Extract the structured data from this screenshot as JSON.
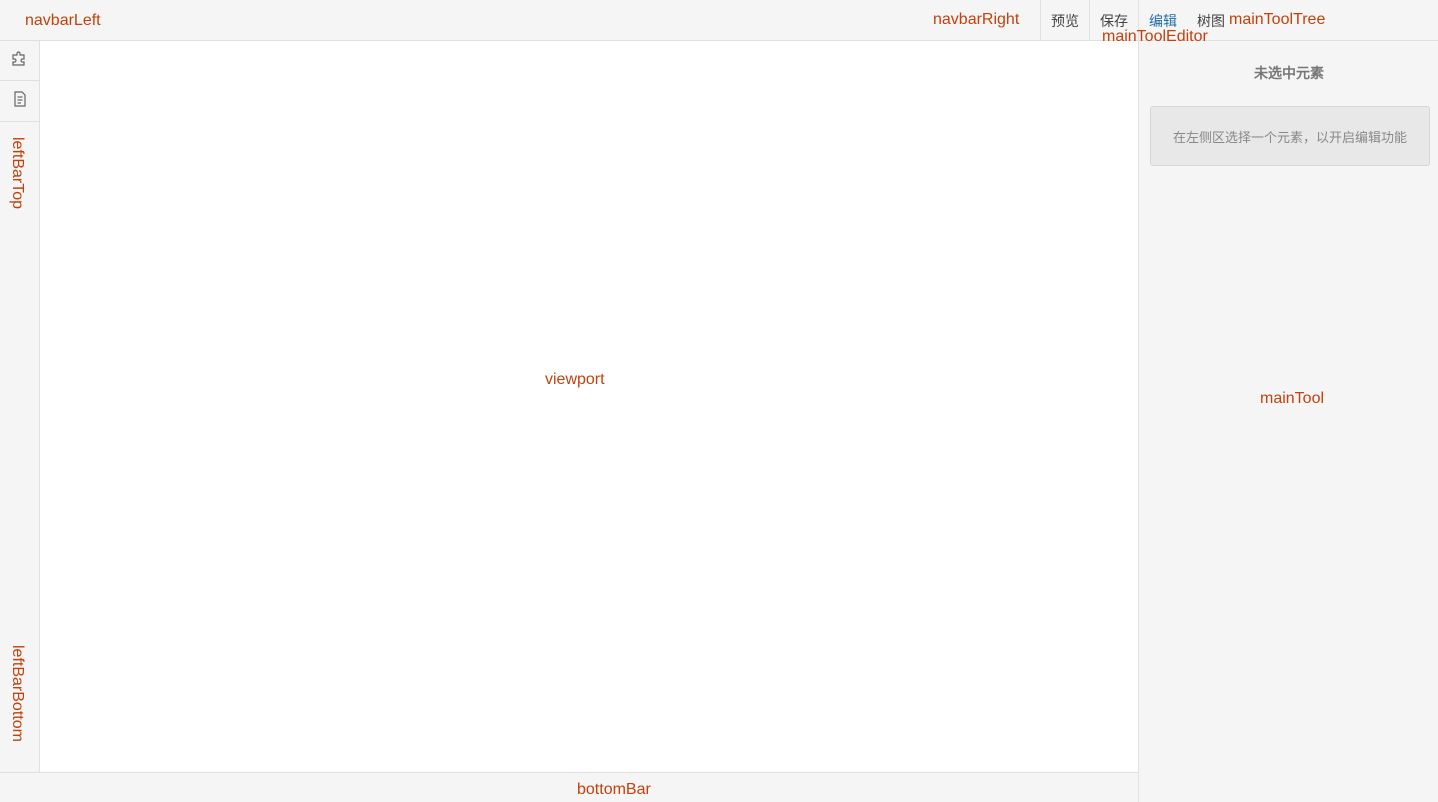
{
  "navbar": {
    "left_label": "navbarLeft",
    "right_label": "navbarRight",
    "buttons": {
      "preview": "预览",
      "save": "保存",
      "edit": "编辑",
      "tree": "树图"
    },
    "tool_editor_label": "mainToolEditor",
    "tool_tree_label": "mainToolTree"
  },
  "leftbar": {
    "icons": [
      "puzzle-icon",
      "document-icon"
    ],
    "top_label": "leftBarTop",
    "bottom_label": "leftBarBottom"
  },
  "viewport": {
    "label": "viewport"
  },
  "maintool": {
    "title": "未选中元素",
    "hint": "在左侧区选择一个元素，以开启编辑功能",
    "label": "mainTool"
  },
  "bottombar": {
    "label": "bottomBar"
  },
  "colors": {
    "label_accent": "#c2410c",
    "active_tab": "#1f6fa3",
    "panel_bg": "#f5f5f5"
  }
}
